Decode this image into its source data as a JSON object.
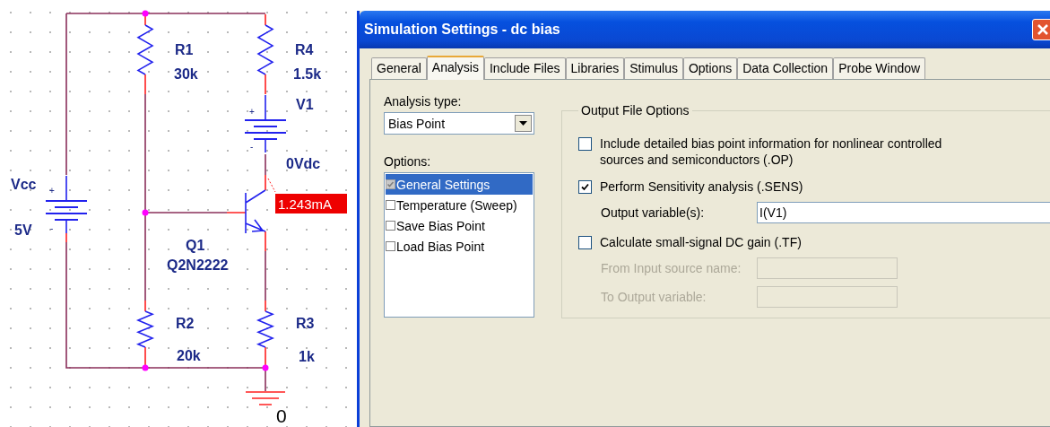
{
  "schematic": {
    "resistors": [
      {
        "ref": "R1",
        "value": "30k"
      },
      {
        "ref": "R4",
        "value": "1.5k"
      },
      {
        "ref": "R2",
        "value": "20k"
      },
      {
        "ref": "R3",
        "value": "1k"
      }
    ],
    "sources": [
      {
        "ref": "Vcc",
        "value": "5V",
        "plus": "+",
        "minus": "-"
      },
      {
        "ref": "V1",
        "value": "0Vdc",
        "plus": "+",
        "minus": "-"
      }
    ],
    "transistor": {
      "ref": "Q1",
      "model": "Q2N2222"
    },
    "current_marker": "1.243mA",
    "ground": "0"
  },
  "dialog": {
    "title": "Simulation Settings - dc bias",
    "tabs": [
      {
        "label": "General",
        "selected": false
      },
      {
        "label": "Analysis",
        "selected": true
      },
      {
        "label": "Include Files",
        "selected": false
      },
      {
        "label": "Libraries",
        "selected": false
      },
      {
        "label": "Stimulus",
        "selected": false
      },
      {
        "label": "Options",
        "selected": false
      },
      {
        "label": "Data Collection",
        "selected": false
      },
      {
        "label": "Probe Window",
        "selected": false
      }
    ],
    "analysis_type": {
      "label": "Analysis type:",
      "value": "Bias Point"
    },
    "options": {
      "label": "Options:",
      "items": [
        {
          "label": "General Settings",
          "checked": true,
          "disabled": true,
          "selected": true
        },
        {
          "label": "Temperature (Sweep)",
          "checked": false,
          "disabled": false,
          "selected": false
        },
        {
          "label": "Save Bias Point",
          "checked": false,
          "disabled": false,
          "selected": false
        },
        {
          "label": "Load Bias Point",
          "checked": false,
          "disabled": false,
          "selected": false
        }
      ]
    },
    "output_file_options": {
      "title": "Output File Options",
      "items": [
        {
          "kind": "checkbox",
          "label": "Include detailed bias point information for nonlinear controlled sources and semiconductors (.OP)",
          "checked": false
        },
        {
          "kind": "checkbox",
          "label": "Perform Sensitivity analysis (.SENS)",
          "checked": true
        },
        {
          "kind": "field",
          "label": "Output variable(s):",
          "value": "I(V1)",
          "disabled": false
        },
        {
          "kind": "checkbox",
          "label": "Calculate small-signal DC gain (.TF)",
          "checked": false
        },
        {
          "kind": "field",
          "label": "From Input source name:",
          "disabled": true
        },
        {
          "kind": "field",
          "label": "To Output variable:",
          "disabled": true
        }
      ]
    }
  }
}
